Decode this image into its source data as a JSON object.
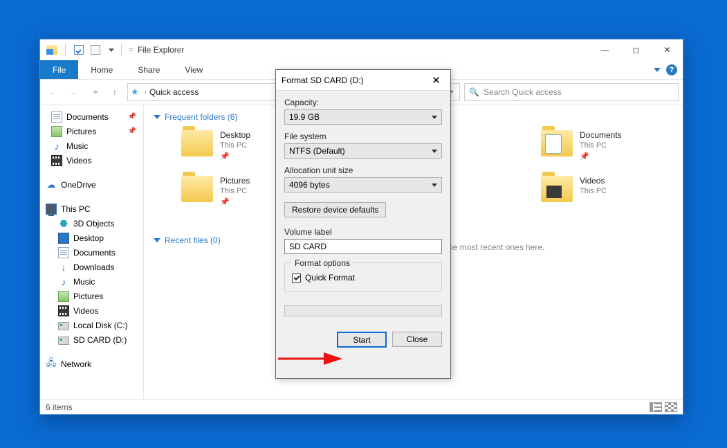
{
  "titlebar": {
    "title": "File Explorer",
    "eq": "="
  },
  "ribbon": {
    "file": "File",
    "tabs": [
      "Home",
      "Share",
      "View"
    ]
  },
  "address": {
    "text": "Quick access",
    "search_placeholder": "Search Quick access"
  },
  "sidebar": {
    "quick": [
      {
        "label": "Documents",
        "icon": "doc",
        "pinned": true
      },
      {
        "label": "Pictures",
        "icon": "pic",
        "pinned": true
      },
      {
        "label": "Music",
        "icon": "music"
      },
      {
        "label": "Videos",
        "icon": "vid"
      }
    ],
    "onedrive": "OneDrive",
    "thispc": "This PC",
    "thispc_items": [
      {
        "label": "3D Objects",
        "icon": "cube"
      },
      {
        "label": "Desktop",
        "icon": "desktop"
      },
      {
        "label": "Documents",
        "icon": "doc"
      },
      {
        "label": "Downloads",
        "icon": "downloads"
      },
      {
        "label": "Music",
        "icon": "music"
      },
      {
        "label": "Pictures",
        "icon": "pic"
      },
      {
        "label": "Videos",
        "icon": "vid"
      },
      {
        "label": "Local Disk (C:)",
        "icon": "disk"
      },
      {
        "label": "SD CARD (D:)",
        "icon": "disk"
      }
    ],
    "network": "Network"
  },
  "main": {
    "frequent_header": "Frequent folders (6)",
    "recent_header": "Recent files (0)",
    "helper": "he most recent ones here.",
    "items": [
      {
        "title": "Desktop",
        "sub": "This PC",
        "pin": true
      },
      {
        "title": "Documents",
        "sub": "This PC",
        "pin": true,
        "style": "docfolder"
      },
      {
        "title": "Pictures",
        "sub": "This PC",
        "pin": true
      },
      {
        "title": "Videos",
        "sub": "This PC",
        "style": "vidfolder"
      }
    ]
  },
  "status": {
    "count": "6 items"
  },
  "dialog": {
    "title": "Format SD CARD (D:)",
    "capacity_label": "Capacity:",
    "capacity_value": "19.9 GB",
    "filesystem_label": "File system",
    "filesystem_value": "NTFS (Default)",
    "alloc_label": "Allocation unit size",
    "alloc_value": "4096 bytes",
    "restore_btn": "Restore device defaults",
    "volume_label": "Volume label",
    "volume_value": "SD CARD",
    "options_legend": "Format options",
    "quick_format": "Quick Format",
    "start": "Start",
    "close": "Close"
  }
}
